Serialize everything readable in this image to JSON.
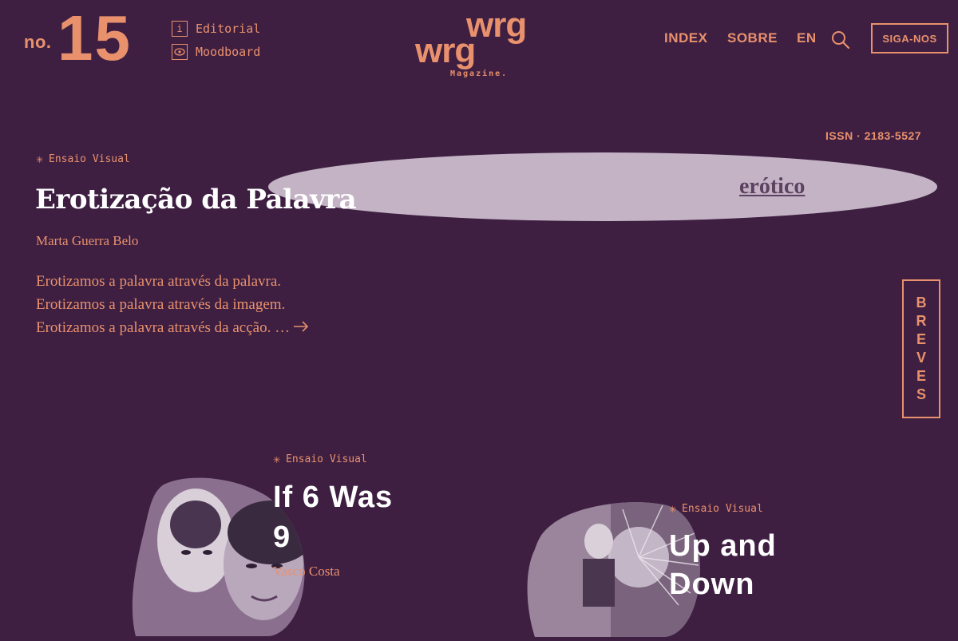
{
  "header": {
    "issue_prefix": "no.",
    "issue_number": "15",
    "links": {
      "editorial": "Editorial",
      "moodboard": "Moodboard"
    },
    "logo": {
      "line1": "wrg",
      "line2": "wrg",
      "tagline": "Magazine."
    },
    "nav": {
      "index": "INDEX",
      "sobre": "SOBRE",
      "language": "EN"
    },
    "follow_label": "SIGA-NOS",
    "issn": "ISSN · 2183-5527"
  },
  "featured": {
    "category": "Ensaio Visual",
    "title": "Erotização da Palavra",
    "author": "Marta Guerra Belo",
    "excerpt": [
      "Erotizamos a palavra através da palavra.",
      "Erotizamos a palavra através da imagem.",
      "Erotizamos a palavra através da acção. …"
    ],
    "image_word": "erótico"
  },
  "breves_label": [
    "B",
    "R",
    "E",
    "V",
    "E",
    "S"
  ],
  "articles": [
    {
      "category": "Ensaio Visual",
      "title_lines": [
        "If 6 Was",
        "9"
      ],
      "author": "Vasco Costa"
    },
    {
      "category": "Ensaio Visual",
      "title_lines": [
        "Up and",
        "Down"
      ]
    }
  ],
  "colors": {
    "background": "#3e1f42",
    "accent": "#e9916c",
    "title_text": "#ffffff",
    "image_tint": "#c3b3c5"
  },
  "icons": {
    "editorial": "info-icon",
    "moodboard": "eye-icon",
    "search": "search-icon",
    "category": "asterisk-icon",
    "more": "arrow-right-icon"
  }
}
